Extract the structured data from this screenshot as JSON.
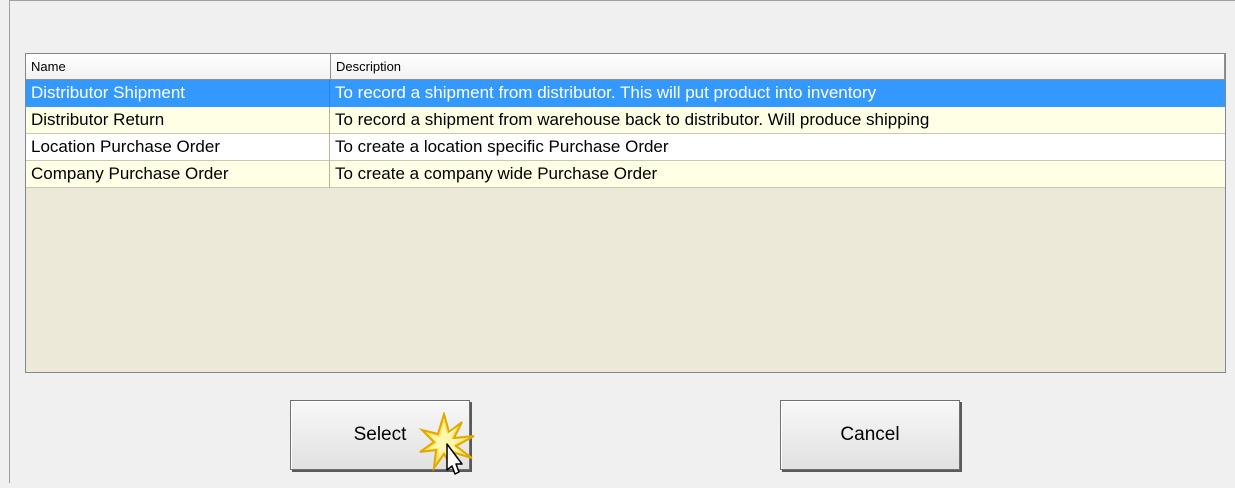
{
  "list": {
    "columns": [
      {
        "label": "Name"
      },
      {
        "label": "Description"
      }
    ],
    "rows": [
      {
        "name": "Distributor Shipment",
        "description": "To record a shipment from distributor.  This will put product into inventory",
        "state": "selected"
      },
      {
        "name": "Distributor Return",
        "description": "To record a shipment from warehouse back to distributor.  Will produce shipping",
        "state": "alt"
      },
      {
        "name": "Location Purchase Order",
        "description": "To create a location specific Purchase Order",
        "state": "plain"
      },
      {
        "name": "Company Purchase Order",
        "description": "To create a company wide Purchase Order",
        "state": "alt"
      }
    ]
  },
  "buttons": {
    "select_label": "Select",
    "cancel_label": "Cancel"
  },
  "colors": {
    "selection": "#3399ff",
    "alt_row": "#ffffe6",
    "list_background": "#ece9d8"
  },
  "icons": {
    "cursor": "pointer-cursor-icon",
    "click_burst": "click-highlight-icon"
  }
}
